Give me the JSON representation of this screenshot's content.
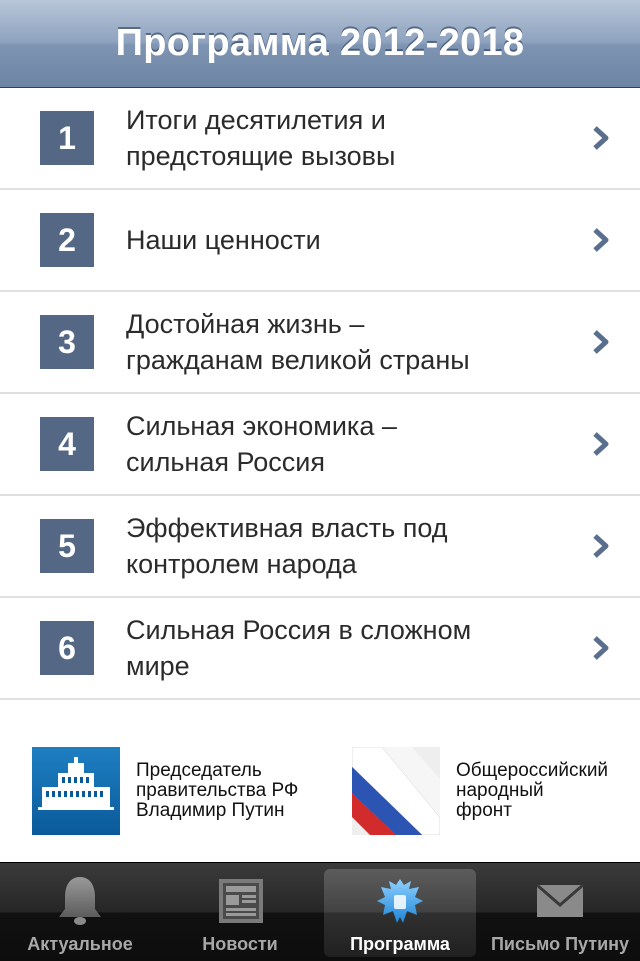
{
  "header": {
    "title": "Программа 2012-2018"
  },
  "sections": [
    {
      "number": "1",
      "title": "Итоги десятилетия и\nпредстоящие вызовы"
    },
    {
      "number": "2",
      "title": "Наши ценности"
    },
    {
      "number": "3",
      "title": "Достойная жизнь –\nгражданам великой страны"
    },
    {
      "number": "4",
      "title": "Сильная экономика –\nсильная Россия"
    },
    {
      "number": "5",
      "title": "Эффективная власть под\nконтролем народа"
    },
    {
      "number": "6",
      "title": "Сильная Россия в сложном\nмире"
    }
  ],
  "partners": [
    {
      "text": "Председатель\nправительства РФ\nВладимир Путин",
      "icon": "government-house-icon"
    },
    {
      "text": "Общероссийский\nнародный\nфронт",
      "icon": "tricolor-flag-icon"
    }
  ],
  "tabs": [
    {
      "label": "Актуальное",
      "icon": "bell-icon",
      "active": false
    },
    {
      "label": "Новости",
      "icon": "newspaper-icon",
      "active": false
    },
    {
      "label": "Программа",
      "icon": "coat-of-arms-icon",
      "active": true
    },
    {
      "label": "Письмо Путину",
      "icon": "envelope-icon",
      "active": false
    }
  ],
  "colors": {
    "accent": "#546886",
    "navbar": "#7e94b2",
    "tabbar": "#1a1a1a"
  }
}
